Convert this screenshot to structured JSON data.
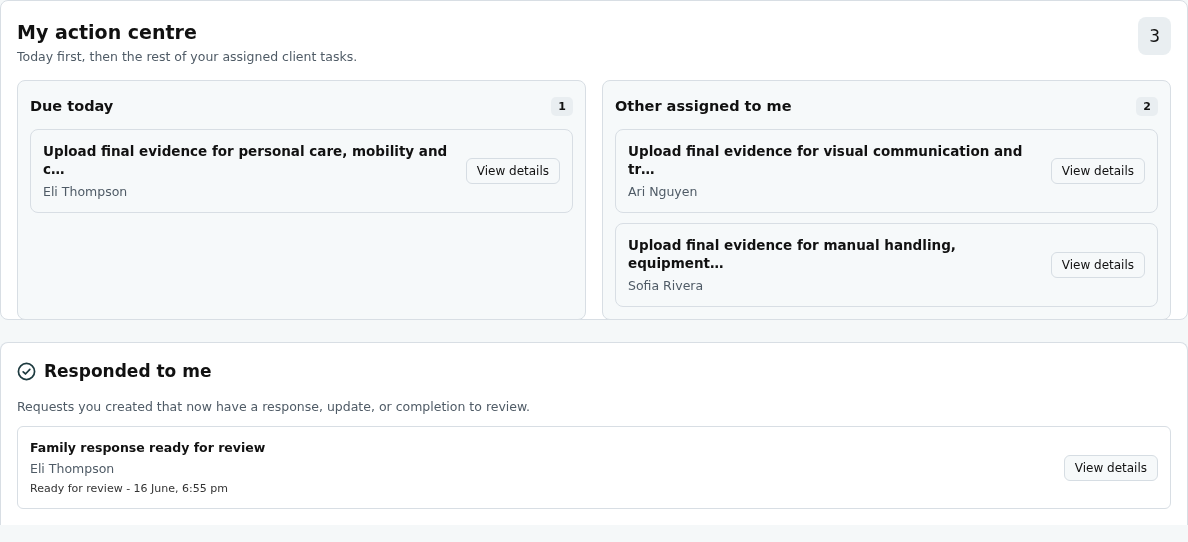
{
  "action_centre": {
    "title": "My action centre",
    "subtitle": "Today first, then the rest of your assigned client tasks.",
    "count": "3",
    "panels": [
      {
        "title": "Due today",
        "count": "1",
        "tasks": [
          {
            "title": "Upload final evidence for personal care, mobility and c…",
            "client": "Eli Thompson",
            "button": "View details"
          }
        ]
      },
      {
        "title": "Other assigned to me",
        "count": "2",
        "tasks": [
          {
            "title": "Upload final evidence for visual communication and tr…",
            "client": "Ari Nguyen",
            "button": "View details"
          },
          {
            "title": "Upload final evidence for manual handling, equipment…",
            "client": "Sofia Rivera",
            "button": "View details"
          }
        ]
      }
    ]
  },
  "responded": {
    "title": "Responded to me",
    "description": "Requests you created that now have a response, update, or completion to review.",
    "items": [
      {
        "title": "Family response ready for review",
        "client": "Eli Thompson",
        "meta": "Ready for review - 16 June, 6:55 pm",
        "button": "View details"
      }
    ]
  }
}
